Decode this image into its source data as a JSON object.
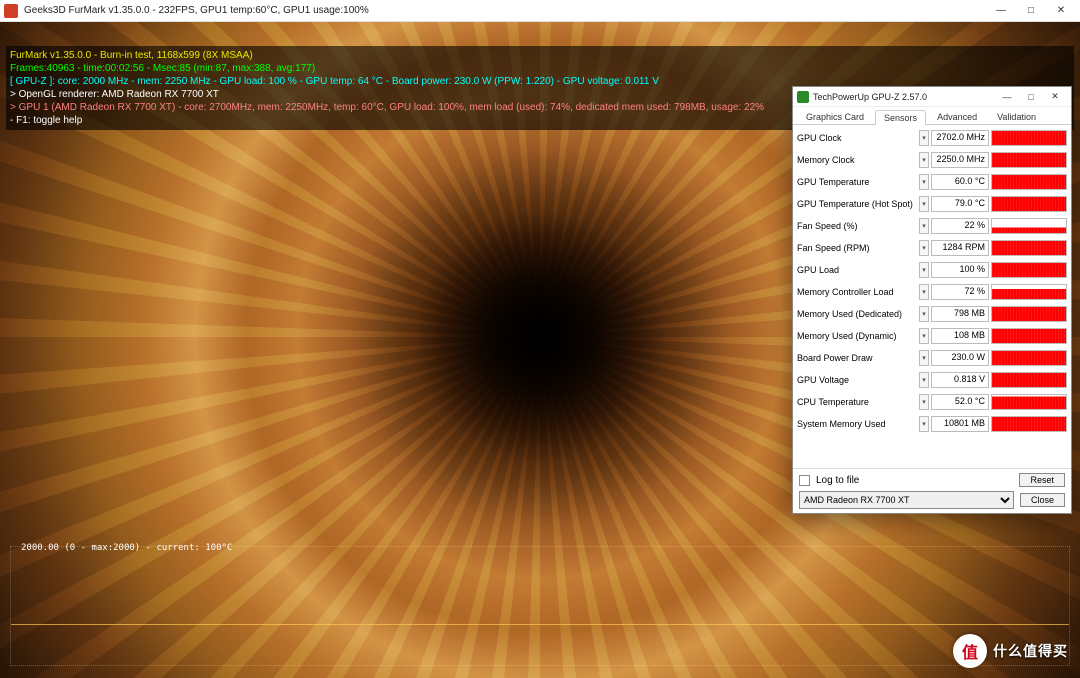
{
  "furmark": {
    "title": "Geeks3D FurMark v1.35.0.0 - 232FPS, GPU1 temp:60°C, GPU1 usage:100%",
    "overlay": {
      "line1": "FurMark v1.35.0.0 - Burn-in test, 1168x599 (8X MSAA)",
      "line2": "Frames:40963 - time:00:02:56 - Msec:85 (min:87, max:388, avg:177)",
      "line3": "[ GPU-Z ]: core: 2000 MHz - mem: 2250 MHz - GPU load: 100 % - GPU temp: 64 °C - Board power: 230.0 W (PPW: 1.220) - GPU voltage: 0.011 V",
      "line4": "> OpenGL renderer: AMD Radeon RX 7700 XT",
      "line5": "> GPU 1 (AMD Radeon RX 7700 XT) - core: 2700MHz, mem: 2250MHz, temp: 60°C, GPU load: 100%, mem load (used): 74%, dedicated mem used: 798MB, usage: 22%",
      "line6": "- F1: toggle help"
    },
    "graph_label": "2000.00 (0 - max:2000) - current: 100°C"
  },
  "gpuz": {
    "title": "TechPowerUp GPU-Z 2.57.0",
    "tabs": [
      "Graphics Card",
      "Sensors",
      "Advanced",
      "Validation"
    ],
    "active_tab": 1,
    "sensors": [
      {
        "name": "GPU Clock",
        "value": "2702.0 MHz",
        "fill": 100
      },
      {
        "name": "Memory Clock",
        "value": "2250.0 MHz",
        "fill": 100
      },
      {
        "name": "GPU Temperature",
        "value": "60.0 °C",
        "fill": 100
      },
      {
        "name": "GPU Temperature (Hot Spot)",
        "value": "79.0 °C",
        "fill": 100
      },
      {
        "name": "Fan Speed (%)",
        "value": "22 %",
        "fill": 40
      },
      {
        "name": "Fan Speed (RPM)",
        "value": "1284 RPM",
        "fill": 100
      },
      {
        "name": "GPU Load",
        "value": "100 %",
        "fill": 100
      },
      {
        "name": "Memory Controller Load",
        "value": "72 %",
        "fill": 72
      },
      {
        "name": "Memory Used (Dedicated)",
        "value": "798 MB",
        "fill": 100
      },
      {
        "name": "Memory Used (Dynamic)",
        "value": "108 MB",
        "fill": 100
      },
      {
        "name": "Board Power Draw",
        "value": "230.0 W",
        "fill": 100
      },
      {
        "name": "GPU Voltage",
        "value": "0.818 V",
        "fill": 100
      },
      {
        "name": "CPU Temperature",
        "value": "52.0 °C",
        "fill": 90
      },
      {
        "name": "System Memory Used",
        "value": "10801 MB",
        "fill": 100
      }
    ],
    "log_label": "Log to file",
    "reset_label": "Reset",
    "close_label": "Close",
    "device": "AMD Radeon RX 7700 XT"
  },
  "watermark": {
    "badge": "值",
    "text": "什么值得买"
  },
  "win_controls": {
    "min": "—",
    "max": "□",
    "close": "✕"
  }
}
